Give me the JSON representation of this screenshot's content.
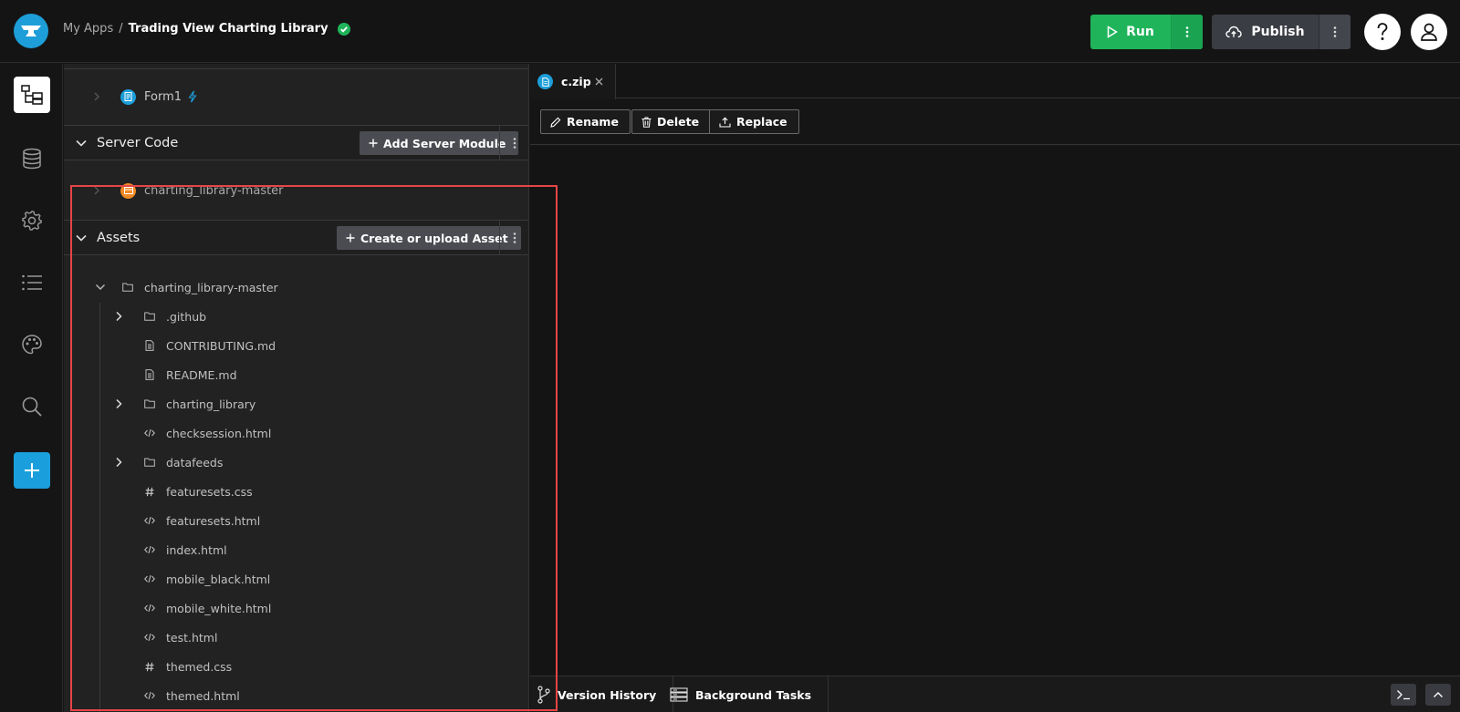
{
  "header": {
    "breadcrumb_root": "My Apps",
    "breadcrumb_sep": "/",
    "app_name": "Trading View Charting Library",
    "run_label": "Run",
    "publish_label": "Publish"
  },
  "colors": {
    "accent": "#1d9ed9",
    "run_green": "#1fb45a",
    "highlight_red": "#e64545"
  },
  "rail": {
    "items": [
      "app-browser-icon",
      "database-icon",
      "settings-icon",
      "list-icon",
      "palette-icon",
      "search-icon",
      "plus-icon"
    ]
  },
  "explorer": {
    "form_item": "Form1",
    "server_code": {
      "title": "Server Code",
      "add_button": "Add Server Module",
      "item": "charting_library-master"
    },
    "assets": {
      "title": "Assets",
      "add_button": "Create or upload Asset",
      "root": "charting_library-master",
      "children": [
        {
          "name": ".github",
          "type": "folder"
        },
        {
          "name": "CONTRIBUTING.md",
          "type": "file"
        },
        {
          "name": "README.md",
          "type": "file"
        },
        {
          "name": "charting_library",
          "type": "folder"
        },
        {
          "name": "checksession.html",
          "type": "code"
        },
        {
          "name": "datafeeds",
          "type": "folder"
        },
        {
          "name": "featuresets.css",
          "type": "css"
        },
        {
          "name": "featuresets.html",
          "type": "code"
        },
        {
          "name": "index.html",
          "type": "code"
        },
        {
          "name": "mobile_black.html",
          "type": "code"
        },
        {
          "name": "mobile_white.html",
          "type": "code"
        },
        {
          "name": "test.html",
          "type": "code"
        },
        {
          "name": "themed.css",
          "type": "css"
        },
        {
          "name": "themed.html",
          "type": "code"
        }
      ]
    }
  },
  "editor": {
    "tab_label": "c.zip",
    "toolbar": {
      "rename": "Rename",
      "delete": "Delete",
      "replace": "Replace"
    }
  },
  "bottom": {
    "version_history": "Version History",
    "background_tasks": "Background Tasks"
  }
}
